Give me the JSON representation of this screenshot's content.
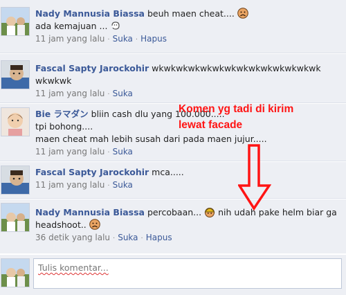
{
  "comments": [
    {
      "name": "Nady Mannusia Biassa",
      "text1": "beuh maen cheat....",
      "text2": "ada kemajuan ...",
      "time": "11 jam yang lalu",
      "like": "Suka",
      "delete": "Hapus"
    },
    {
      "name": "Fascal Sapty Jarockohir",
      "text1": "wkwkwkwkwkwkwkwkwkwkwkwkwkwk",
      "text2": "wkwkwk",
      "time": "11 jam yang lalu",
      "like": "Suka"
    },
    {
      "name": "Bie ラマダン",
      "text1": "bliin cash dlu yang 100.000.....",
      "text2": "tpi bohong....",
      "text3": "maen cheat mah lebih susah dari pada maen jujur.....",
      "time": "11 jam yang lalu",
      "like": "Suka"
    },
    {
      "name": "Fascal Sapty Jarockohir",
      "text1": "mca.....",
      "time": "11 jam yang lalu",
      "like": "Suka"
    },
    {
      "name": "Nady Mannusia Biassa",
      "text1": "percobaan...",
      "text1b": "nih udah pake helm biar ga",
      "text2": "headshoot..",
      "time": "36 detik yang lalu",
      "like": "Suka",
      "delete": "Hapus"
    }
  ],
  "annotation": {
    "line1": "Komen yg tadi di kirim",
    "line2": "lewat facade"
  },
  "composer": {
    "placeholder": "Tulis komentar..."
  },
  "icons": {
    "frown": "frown-emoticon-icon",
    "smile": "smile-emoticon-icon",
    "helmet": "helmet-emoticon-icon",
    "arrow": "red-down-arrow"
  },
  "colors": {
    "name_link": "#3b5998",
    "annotation": "#ff1414",
    "row_bg": "#edeff4"
  }
}
